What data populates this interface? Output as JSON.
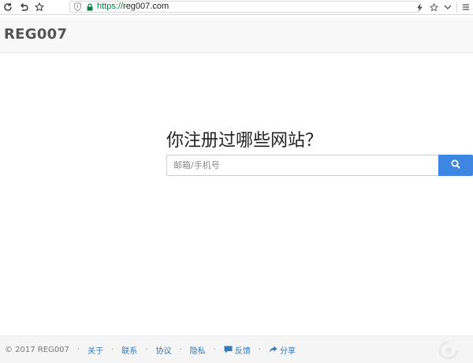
{
  "browser": {
    "url_scheme": "https://",
    "url_host": "reg007.com"
  },
  "header": {
    "brand": "REG007"
  },
  "hero": {
    "title": "你注册过哪些网站？",
    "search_placeholder": "邮箱/手机号"
  },
  "footer": {
    "copyright": "© 2017 REG007",
    "links": {
      "about": "关于",
      "contact": "联系",
      "agreement": "协议",
      "privacy": "隐私",
      "feedback": "反馈",
      "share": "分享"
    },
    "separator": "·"
  },
  "colors": {
    "search_button": "#3d86e2",
    "link": "#337ab7",
    "secure_green": "#0b8043"
  },
  "icons": {
    "refresh": "refresh-icon",
    "undo": "undo-icon",
    "bookmark": "star-icon",
    "shield": "shield-icon",
    "lock": "lock-icon",
    "search": "search-icon",
    "comment": "comment-icon",
    "share": "share-icon"
  }
}
